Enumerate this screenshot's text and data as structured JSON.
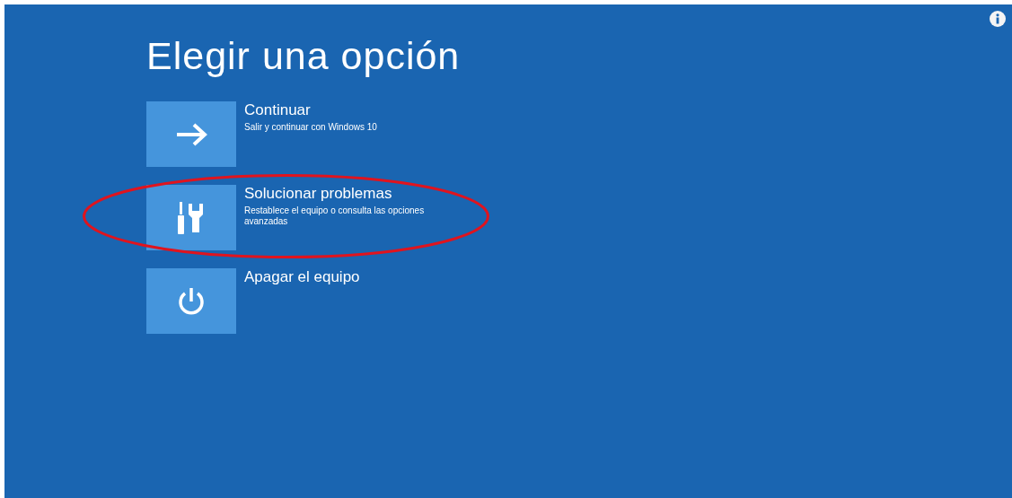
{
  "title": "Elegir una opción",
  "options": [
    {
      "kind": "arrow",
      "label": "Continuar",
      "description": "Salir y continuar con Windows 10",
      "highlighted": false
    },
    {
      "kind": "tools",
      "label": "Solucionar problemas",
      "description": "Restablece el equipo o consulta las opciones avanzadas",
      "highlighted": true
    },
    {
      "kind": "power",
      "label": "Apagar el equipo",
      "highlighted": false
    }
  ]
}
